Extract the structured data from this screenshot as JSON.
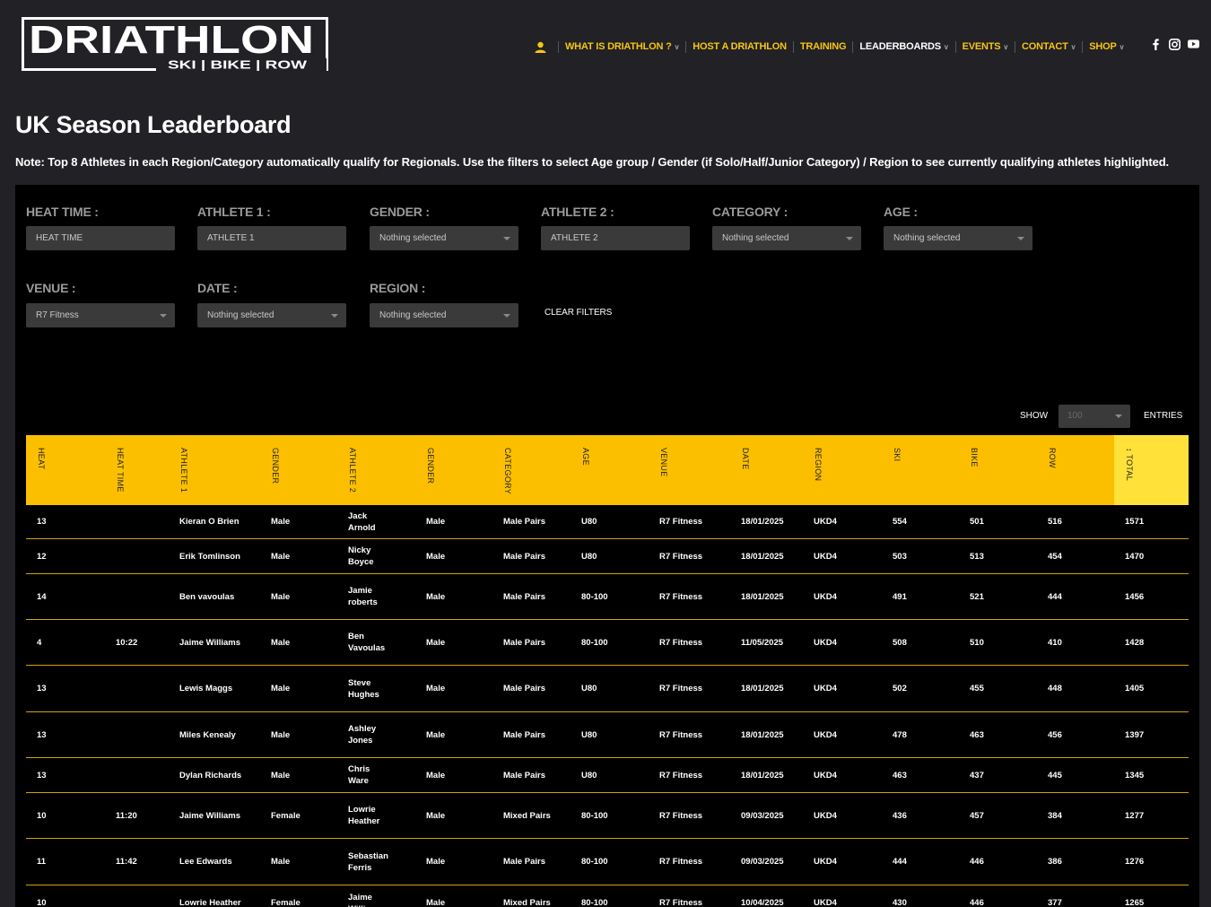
{
  "header": {
    "logo": {
      "main": "DRIATHLON",
      "sub": "SKI | BIKE | ROW"
    },
    "nav": [
      {
        "label": "WHAT IS DRIATHLON ?",
        "dropdown": true,
        "active": false
      },
      {
        "label": "HOST A DRIATHLON",
        "dropdown": false,
        "active": false
      },
      {
        "label": "TRAINING",
        "dropdown": false,
        "active": false
      },
      {
        "label": "LEADERBOARDS",
        "dropdown": true,
        "active": true
      },
      {
        "label": "EVENTS",
        "dropdown": true,
        "active": false
      },
      {
        "label": "CONTACT",
        "dropdown": true,
        "active": false
      },
      {
        "label": "SHOP",
        "dropdown": true,
        "active": false
      }
    ],
    "social": [
      "facebook-icon",
      "instagram-icon",
      "youtube-icon"
    ]
  },
  "page": {
    "title": "UK Season Leaderboard",
    "note": "Note: Top 8 Athletes in each Region/Category automatically qualify for Regionals. Use the filters to select Age group / Gender (if Solo/Half/Junior Category) / Region to see currently qualifying athletes highlighted."
  },
  "filters": {
    "heat_time": {
      "label": "HEAT TIME :",
      "placeholder": "HEAT TIME"
    },
    "athlete1": {
      "label": "ATHLETE 1 :",
      "placeholder": "ATHLETE 1"
    },
    "gender": {
      "label": "GENDER :",
      "value": "Nothing selected"
    },
    "athlete2": {
      "label": "ATHLETE 2 :",
      "placeholder": "ATHLETE 2"
    },
    "category": {
      "label": "CATEGORY :",
      "value": "Nothing selected"
    },
    "age": {
      "label": "AGE :",
      "value": "Nothing selected"
    },
    "venue": {
      "label": "VENUE :",
      "value": "R7 Fitness"
    },
    "date": {
      "label": "DATE :",
      "value": "Nothing selected"
    },
    "region": {
      "label": "REGION :",
      "value": "Nothing selected"
    },
    "clear": "CLEAR FILTERS"
  },
  "table_controls": {
    "show": "SHOW",
    "page_size": "100",
    "entries": "ENTRIES"
  },
  "columns": [
    "HEAT",
    "HEAT TIME",
    "ATHLETE 1",
    "GENDER",
    "ATHLETE 2",
    "GENDER",
    "CATEGORY",
    "AGE",
    "VENUE",
    "DATE",
    "REGION",
    "SKI",
    "BIKE",
    "ROW",
    "TOTAL"
  ],
  "sorted_column": "TOTAL",
  "rows": [
    [
      "13",
      "",
      "Kieran O Brien",
      "Male",
      "Jack Arnold",
      "Male",
      "Male Pairs",
      "U80",
      "R7 Fitness",
      "18/01/2025",
      "UKD4",
      "554",
      "501",
      "516",
      "1571"
    ],
    [
      "12",
      "",
      "Erik Tomlinson",
      "Male",
      "Nicky Boyce",
      "Male",
      "Male Pairs",
      "U80",
      "R7 Fitness",
      "18/01/2025",
      "UKD4",
      "503",
      "513",
      "454",
      "1470"
    ],
    [
      "14",
      "",
      "Ben vavoulas",
      "Male",
      "Jamie roberts",
      "Male",
      "Male Pairs",
      "80-100",
      "R7 Fitness",
      "18/01/2025",
      "UKD4",
      "491",
      "521",
      "444",
      "1456"
    ],
    [
      "4",
      "10:22",
      "Jaime Williams",
      "Male",
      "Ben Vavoulas",
      "Male",
      "Male Pairs",
      "80-100",
      "R7 Fitness",
      "11/05/2025",
      "UKD4",
      "508",
      "510",
      "410",
      "1428"
    ],
    [
      "13",
      "",
      "Lewis Maggs",
      "Male",
      "Steve Hughes",
      "Male",
      "Male Pairs",
      "U80",
      "R7 Fitness",
      "18/01/2025",
      "UKD4",
      "502",
      "455",
      "448",
      "1405"
    ],
    [
      "13",
      "",
      "Miles Kenealy",
      "Male",
      "Ashley Jones",
      "Male",
      "Male Pairs",
      "U80",
      "R7 Fitness",
      "18/01/2025",
      "UKD4",
      "478",
      "463",
      "456",
      "1397"
    ],
    [
      "13",
      "",
      "Dylan Richards",
      "Male",
      "Chris Ware",
      "Male",
      "Male Pairs",
      "U80",
      "R7 Fitness",
      "18/01/2025",
      "UKD4",
      "463",
      "437",
      "445",
      "1345"
    ],
    [
      "10",
      "11:20",
      "Jaime Williams",
      "Female",
      "Lowrie Heather",
      "Male",
      "Mixed Pairs",
      "80-100",
      "R7 Fitness",
      "09/03/2025",
      "UKD4",
      "436",
      "457",
      "384",
      "1277"
    ],
    [
      "11",
      "11:42",
      "Lee Edwards",
      "Male",
      "Sebastian Ferris",
      "Male",
      "Male Pairs",
      "80-100",
      "R7 Fitness",
      "09/03/2025",
      "UKD4",
      "444",
      "446",
      "386",
      "1276"
    ],
    [
      "10",
      "",
      "Lowrie Heather",
      "Female",
      "Jaime Williams",
      "Male",
      "Mixed Pairs",
      "80-100",
      "R7 Fitness",
      "10/04/2025",
      "UKD4",
      "430",
      "446",
      "377",
      "1265"
    ]
  ]
}
